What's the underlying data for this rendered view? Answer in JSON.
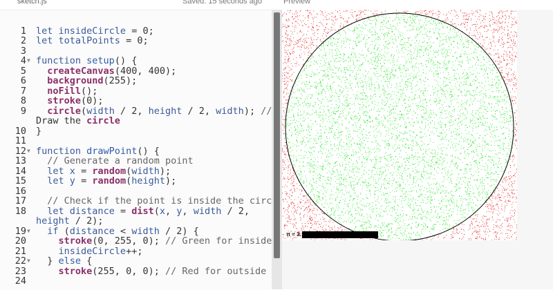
{
  "header": {
    "file_name": "sketch.js",
    "saved_status": "Saved: 15 seconds ago",
    "preview_label": "Preview"
  },
  "editor": {
    "lines": [
      {
        "n": "",
        "text": ""
      },
      {
        "n": "1",
        "text": "let insideCircle = 0;"
      },
      {
        "n": "2",
        "text": "let totalPoints = 0;"
      },
      {
        "n": "3",
        "text": ""
      },
      {
        "n": "4",
        "text": "function setup() {",
        "fold": true
      },
      {
        "n": "5",
        "text": "  createCanvas(400, 400);"
      },
      {
        "n": "6",
        "text": "  background(255);"
      },
      {
        "n": "7",
        "text": "  noFill();"
      },
      {
        "n": "8",
        "text": "  stroke(0);"
      },
      {
        "n": "9",
        "text": "  circle(width / 2, height / 2, width); //"
      },
      {
        "n": "",
        "text": "Draw the circle"
      },
      {
        "n": "10",
        "text": "}"
      },
      {
        "n": "11",
        "text": ""
      },
      {
        "n": "12",
        "text": "function drawPoint() {",
        "fold": true
      },
      {
        "n": "13",
        "text": "  // Generate a random point"
      },
      {
        "n": "14",
        "text": "  let x = random(width);"
      },
      {
        "n": "15",
        "text": "  let y = random(height);"
      },
      {
        "n": "16",
        "text": ""
      },
      {
        "n": "17",
        "text": "  // Check if the point is inside the circle"
      },
      {
        "n": "18",
        "text": "  let distance = dist(x, y, width / 2,"
      },
      {
        "n": "",
        "text": "height / 2);"
      },
      {
        "n": "19",
        "text": "  if (distance < width / 2) {",
        "fold": true
      },
      {
        "n": "20",
        "text": "    stroke(0, 255, 0); // Green for inside"
      },
      {
        "n": "21",
        "text": "    insideCircle++;"
      },
      {
        "n": "22",
        "text": "  } else {",
        "fold": true
      },
      {
        "n": "23",
        "text": "    stroke(255, 0, 0); // Red for outside"
      },
      {
        "n": "24",
        "text": "  "
      }
    ]
  },
  "preview": {
    "pi_label": "π ≈ 3.",
    "colors": {
      "inside": "#00e000",
      "outside": "#e00000",
      "circle": "#000000"
    }
  }
}
